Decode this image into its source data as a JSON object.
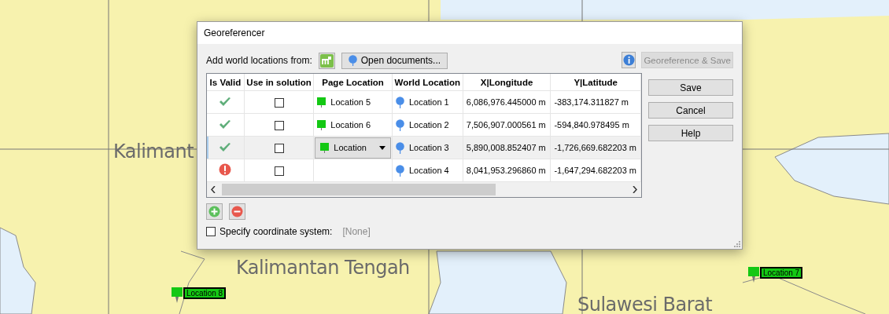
{
  "map": {
    "labels": [
      {
        "text": "Kalimant"
      },
      {
        "text": "Kalimantan Tengah"
      },
      {
        "text": "Sulawesi Barat"
      }
    ],
    "markers": [
      {
        "label": "Location 8"
      },
      {
        "label": "Location 7"
      }
    ]
  },
  "dialog": {
    "title": "Georeferencer",
    "add_label": "Add world locations from:",
    "open_button": "Open documents...",
    "georeference_button": {
      "label": "Georeference & Save",
      "disabled": true
    },
    "buttons": [
      "Save",
      "Cancel",
      "Help"
    ],
    "table": {
      "columns": [
        "Is Valid",
        "Use in solution",
        "Page Location",
        "World Location",
        "X|Longitude",
        "Y|Latitude"
      ],
      "rows": [
        {
          "valid": true,
          "use": false,
          "selected": false,
          "kind": "label",
          "page_location": "Location 5",
          "world_location": "Location 1",
          "x": "6,086,976.445000 m",
          "y": "-383,174.311827 m"
        },
        {
          "valid": true,
          "use": false,
          "selected": false,
          "kind": "label",
          "page_location": "Location 6",
          "world_location": "Location 2",
          "x": "7,506,907.000561 m",
          "y": "-594,840.978495 m"
        },
        {
          "valid": true,
          "use": false,
          "selected": true,
          "kind": "dropdown",
          "page_location": "Location",
          "world_location": "Location 3",
          "x": "5,890,008.852407 m",
          "y": "-1,726,669.682203 m"
        },
        {
          "valid": false,
          "use": false,
          "selected": false,
          "kind": "empty",
          "world_location": "Location 4",
          "x": "8,041,953.296860 m",
          "y": "-1,647,294.682203 m"
        }
      ]
    },
    "specify": {
      "label": "Specify coordinate system:",
      "checked": false,
      "value": "[None]"
    }
  }
}
